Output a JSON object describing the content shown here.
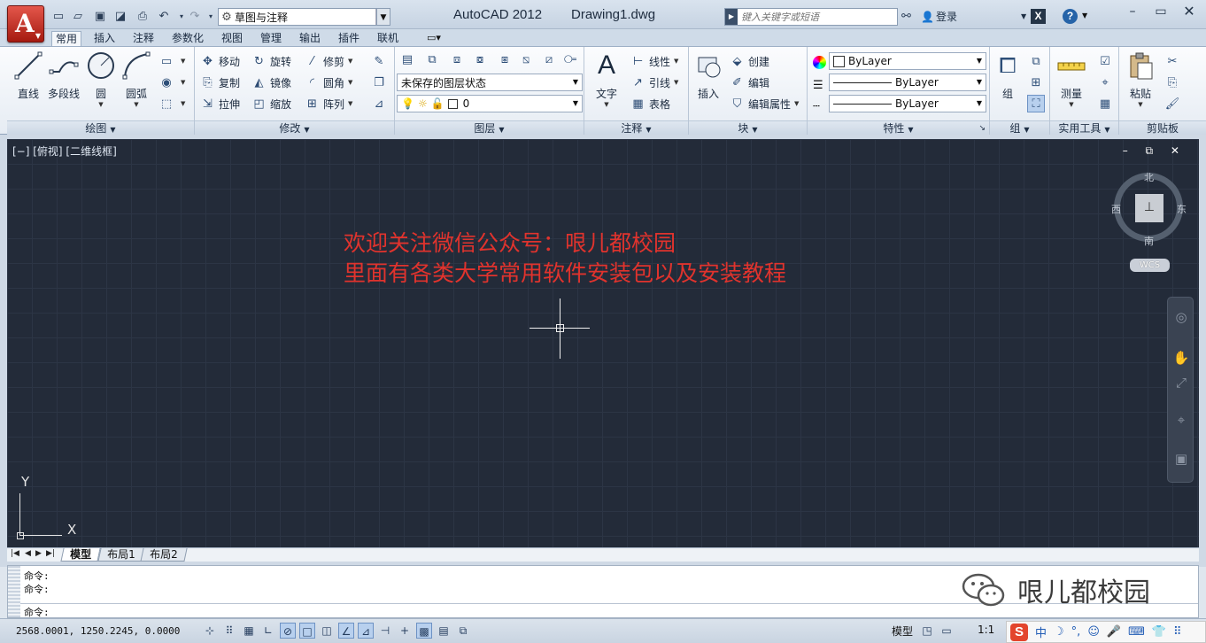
{
  "titlebar": {
    "app_title": "AutoCAD 2012",
    "doc_title": "Drawing1.dwg",
    "workspace": "草图与注释",
    "search_placeholder": "键入关键字或短语",
    "login": "登录"
  },
  "tabs": [
    "常用",
    "插入",
    "注释",
    "参数化",
    "视图",
    "管理",
    "输出",
    "插件",
    "联机"
  ],
  "panels": {
    "draw": {
      "title": "绘图",
      "line": "直线",
      "polyline": "多段线",
      "circle": "圆",
      "arc": "圆弧"
    },
    "modify": {
      "title": "修改",
      "move": "移动",
      "rotate": "旋转",
      "trim": "修剪",
      "copy": "复制",
      "mirror": "镜像",
      "fillet": "圆角",
      "stretch": "拉伸",
      "scale": "缩放",
      "array": "阵列"
    },
    "layers": {
      "title": "图层",
      "layer_state": "未保存的图层状态",
      "current_layer": "0"
    },
    "annotation": {
      "title": "注释",
      "text": "文字",
      "linear": "线性",
      "leader": "引线",
      "table": "表格"
    },
    "block": {
      "title": "块",
      "insert": "插入",
      "create": "创建",
      "edit": "编辑",
      "edit_attributes": "编辑属性"
    },
    "properties": {
      "title": "特性",
      "color": "ByLayer",
      "linetype": "ByLayer",
      "lineweight": "ByLayer"
    },
    "groups": {
      "title": "组",
      "group": "组"
    },
    "utilities": {
      "title": "实用工具",
      "measure": "测量"
    },
    "clipboard": {
      "title": "剪贴板",
      "paste": "粘贴"
    }
  },
  "viewport": {
    "label": "[−] [俯视] [二维线框]",
    "controls": "– ⧉ ✕",
    "welcome_line1": "欢迎关注微信公众号：哏儿都校园",
    "welcome_line2": "里面有各类大学常用软件安装包以及安装教程",
    "compass": {
      "north": "北",
      "south": "南",
      "east": "东",
      "west": "西"
    },
    "wcs": "WCS",
    "ucs_x": "X",
    "ucs_y": "Y"
  },
  "layout_tabs": [
    "模型",
    "布局1",
    "布局2"
  ],
  "command_lines": [
    "命令:",
    "命令:",
    "命令:"
  ],
  "watermark": "哏儿都校园",
  "statusbar": {
    "coords": "2568.0001, 1250.2245, 0.0000",
    "model": "模型",
    "scale": "1:1",
    "ime": "中"
  },
  "colors": {
    "accent_red": "#e0332d",
    "canvas": "#232b39"
  }
}
